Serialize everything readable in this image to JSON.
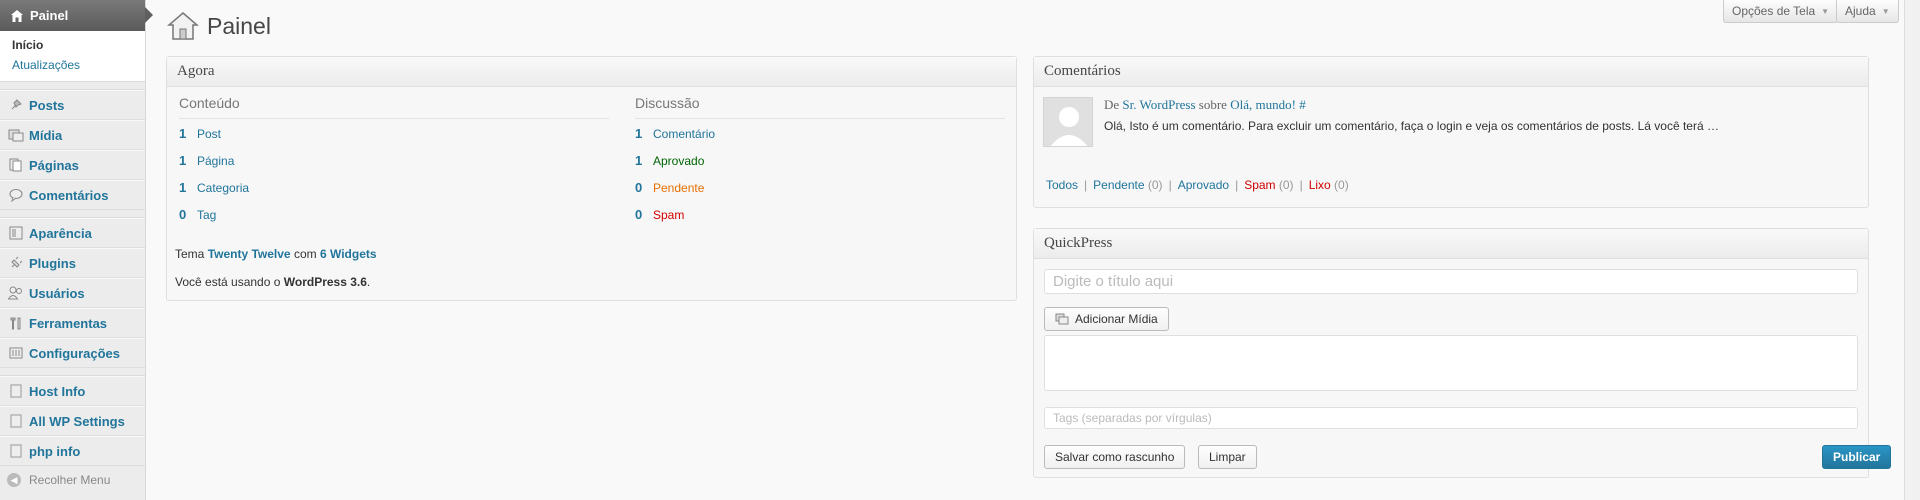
{
  "sidebar": {
    "head_label": "Painel",
    "submenu": [
      {
        "label": "Início",
        "current": true
      },
      {
        "label": "Atualizações",
        "current": false
      }
    ],
    "groups": [
      [
        {
          "label": "Posts",
          "icon": "pin-icon"
        },
        {
          "label": "Mídia",
          "icon": "media-icon"
        },
        {
          "label": "Páginas",
          "icon": "pages-icon"
        },
        {
          "label": "Comentários",
          "icon": "comments-icon"
        }
      ],
      [
        {
          "label": "Aparência",
          "icon": "appearance-icon"
        },
        {
          "label": "Plugins",
          "icon": "plugins-icon"
        },
        {
          "label": "Usuários",
          "icon": "users-icon"
        },
        {
          "label": "Ferramentas",
          "icon": "tools-icon"
        },
        {
          "label": "Configurações",
          "icon": "settings-icon"
        }
      ],
      [
        {
          "label": "Host Info",
          "icon": "generic-page-icon"
        },
        {
          "label": "All WP Settings",
          "icon": "generic-page-icon"
        },
        {
          "label": "php info",
          "icon": "generic-page-icon"
        }
      ]
    ],
    "collapse_label": "Recolher Menu"
  },
  "header": {
    "title": "Painel",
    "screen_options": "Opções de Tela",
    "help": "Ajuda"
  },
  "agora": {
    "title": "Agora",
    "content_heading": "Conteúdo",
    "discussion_heading": "Discussão",
    "content": [
      {
        "num": "1",
        "label": "Post"
      },
      {
        "num": "1",
        "label": "Página"
      },
      {
        "num": "1",
        "label": "Categoria"
      },
      {
        "num": "0",
        "label": "Tag"
      }
    ],
    "discussion": [
      {
        "num": "1",
        "label": "Comentário",
        "color": "#21759b"
      },
      {
        "num": "1",
        "label": "Aprovado",
        "color": "#006505"
      },
      {
        "num": "0",
        "label": "Pendente",
        "color": "#e66f00"
      },
      {
        "num": "0",
        "label": "Spam",
        "color": "#d00000"
      }
    ],
    "theme_prefix": "Tema",
    "theme_name": "Twenty Twelve",
    "theme_mid": "com",
    "widgets": "6 Widgets",
    "version_prefix": "Você está usando o",
    "version": "WordPress 3.6",
    "version_suffix": "."
  },
  "comments": {
    "title": "Comentários",
    "meta_de": "De",
    "author": "Sr. WordPress",
    "meta_sobre": "sobre",
    "post": "Olá, mundo!",
    "hash": "#",
    "excerpt": "Olá, Isto é um comentário. Para excluir um comentário, faça o login e veja os comentários de posts. Lá você terá …",
    "filters": [
      {
        "label": "Todos",
        "count": "",
        "color": "#21759b"
      },
      {
        "label": "Pendente",
        "count": "(0)",
        "color": "#21759b"
      },
      {
        "label": "Aprovado",
        "count": "",
        "color": "#21759b"
      },
      {
        "label": "Spam",
        "count": "(0)",
        "color": "#d00000"
      },
      {
        "label": "Lixo",
        "count": "(0)",
        "color": "#d00000"
      }
    ],
    "separator": "|"
  },
  "quickpress": {
    "title": "QuickPress",
    "title_placeholder": "Digite o título aqui",
    "add_media": "Adicionar Mídia",
    "tags_placeholder": "Tags (separadas por vírgulas)",
    "save_draft": "Salvar como rascunho",
    "reset": "Limpar",
    "publish": "Publicar"
  }
}
